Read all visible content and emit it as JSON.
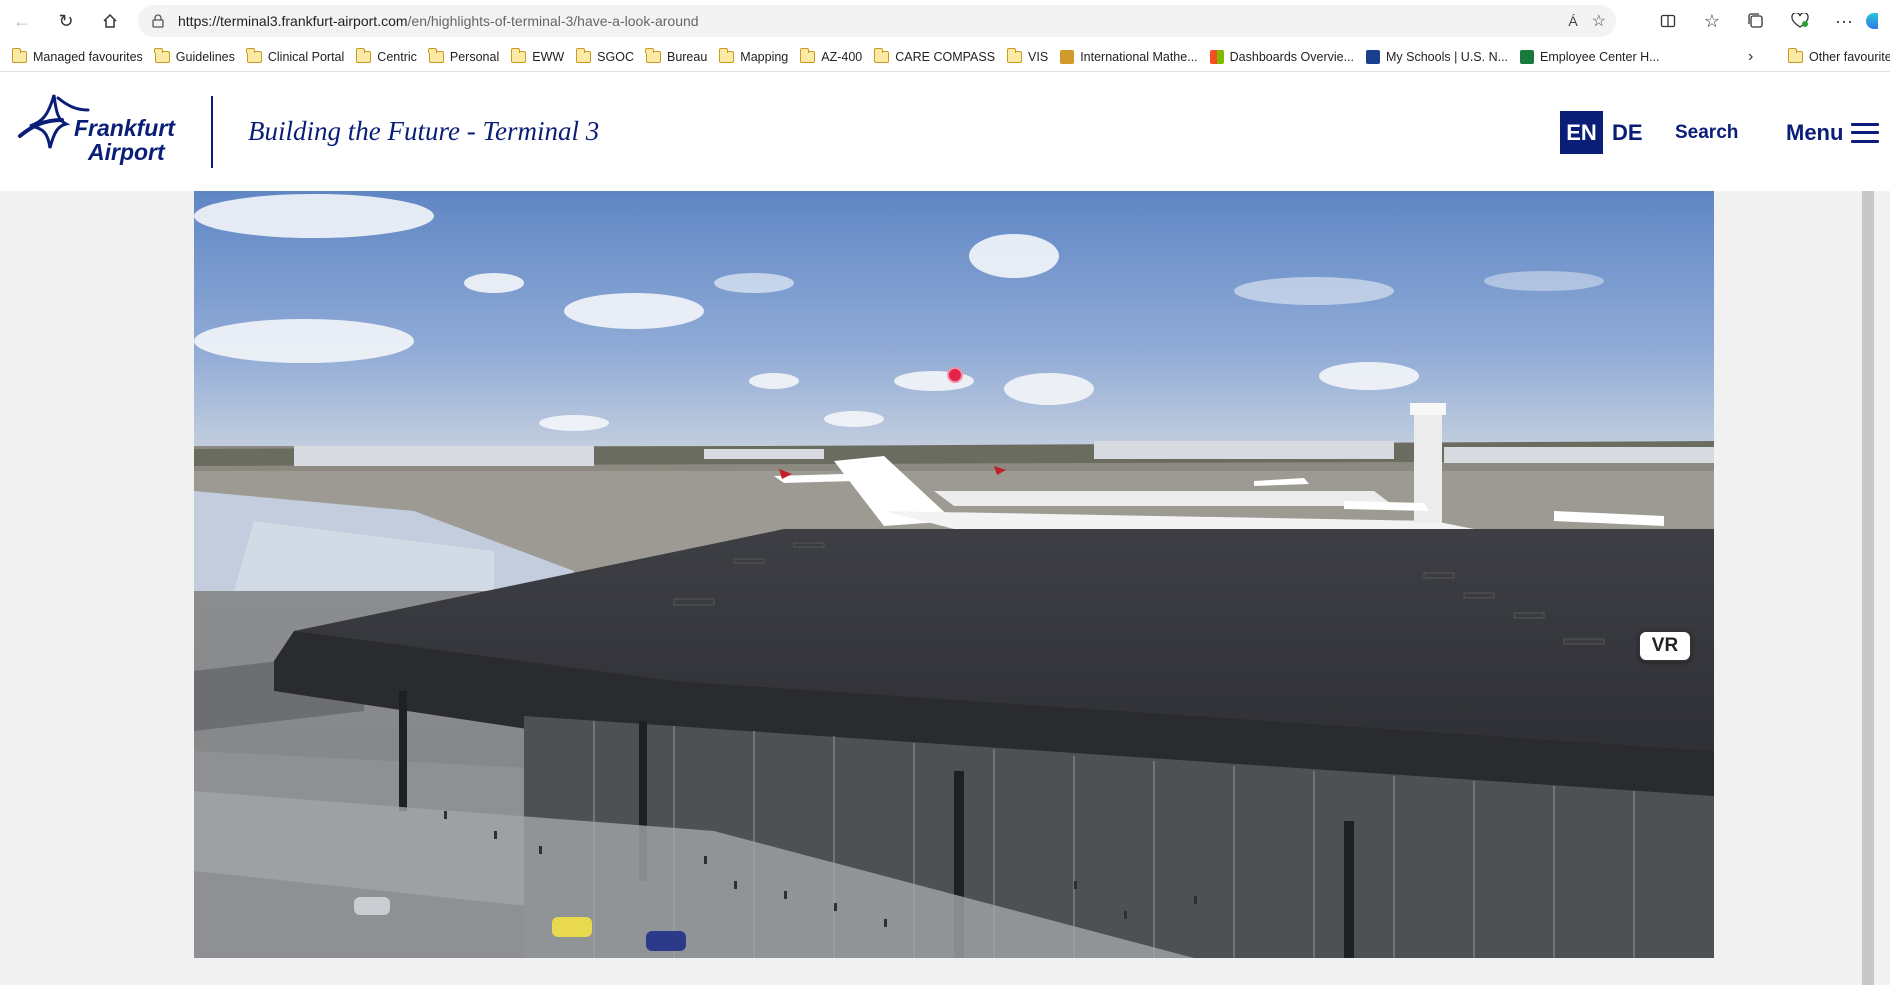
{
  "browser": {
    "url_host": "https://terminal3.frankfurt-airport.com",
    "url_path": "/en/highlights-of-terminal-3/have-a-look-around",
    "read_aloud_icon": "Á"
  },
  "bookmarks": [
    {
      "label": "Managed favourites",
      "icon": "folder-managed"
    },
    {
      "label": "Guidelines",
      "icon": "folder"
    },
    {
      "label": "Clinical Portal",
      "icon": "folder"
    },
    {
      "label": "Centric",
      "icon": "folder"
    },
    {
      "label": "Personal",
      "icon": "folder"
    },
    {
      "label": "EWW",
      "icon": "folder"
    },
    {
      "label": "SGOC",
      "icon": "folder"
    },
    {
      "label": "Bureau",
      "icon": "folder"
    },
    {
      "label": "Mapping",
      "icon": "folder"
    },
    {
      "label": "AZ-400",
      "icon": "folder"
    },
    {
      "label": "CARE COMPASS",
      "icon": "folder"
    },
    {
      "label": "VIS",
      "icon": "folder"
    },
    {
      "label": "International Mathe...",
      "icon": "site-favicon"
    },
    {
      "label": "Dashboards Overvie...",
      "icon": "microsoft-favicon"
    },
    {
      "label": "My Schools | U.S. N...",
      "icon": "usnews-favicon"
    },
    {
      "label": "Employee Center H...",
      "icon": "servicenow-favicon"
    }
  ],
  "bookmarks_other": "Other favourites",
  "site": {
    "logo_line1": "Frankfurt",
    "logo_line2": "Airport",
    "title": "Building the Future - Terminal 3",
    "lang_en": "EN",
    "lang_de": "DE",
    "search": "Search",
    "menu": "Menu"
  },
  "viewer": {
    "vr_label": "VR"
  }
}
